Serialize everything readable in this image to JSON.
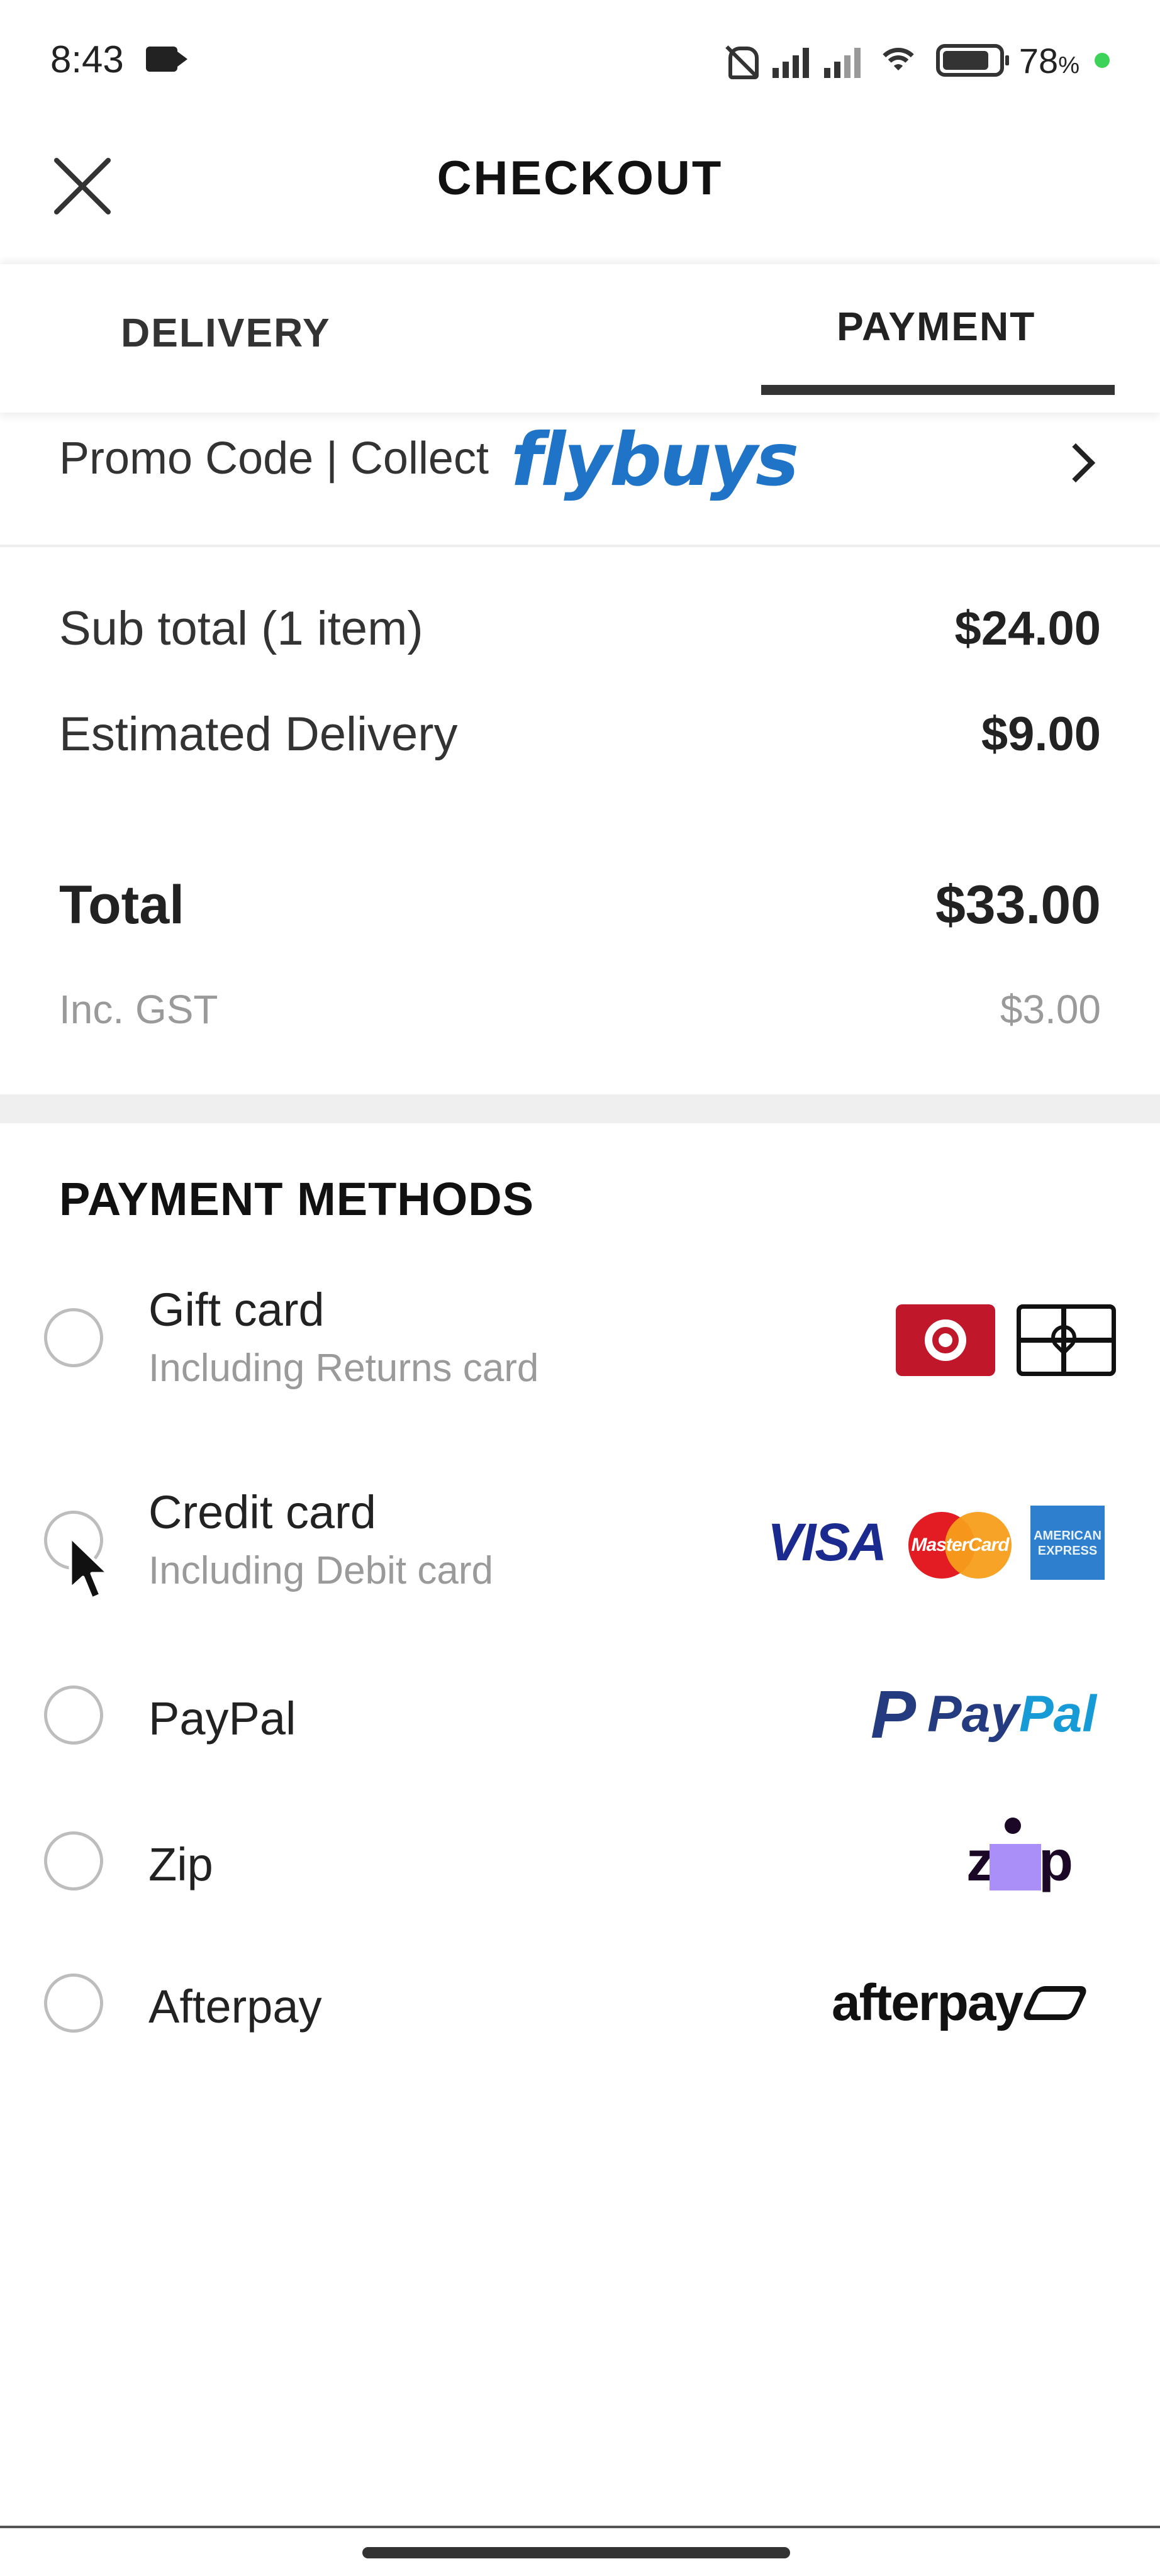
{
  "status_bar": {
    "time": "8:43",
    "battery_text": "78",
    "battery_unit": "%",
    "icons": [
      "video-camera-icon",
      "mute-bell-icon",
      "signal-icon",
      "signal-icon",
      "wifi-icon",
      "battery-icon"
    ]
  },
  "header": {
    "title": "CHECKOUT",
    "close_icon": "close-icon"
  },
  "tabs": [
    {
      "label": "DELIVERY",
      "active": false
    },
    {
      "label": "PAYMENT",
      "active": true
    }
  ],
  "promo": {
    "label": "Promo Code | Collect",
    "brand": "flybuys",
    "chevron_icon": "chevron-right-icon",
    "brand_color": "#1f74c8"
  },
  "summary": {
    "subtotal_label": "Sub total (1 item)",
    "subtotal_value": "$24.00",
    "delivery_label": "Estimated Delivery",
    "delivery_value": "$9.00",
    "total_label": "Total",
    "total_value": "$33.00",
    "gst_label": "Inc. GST",
    "gst_value": "$3.00"
  },
  "payment_methods": {
    "heading": "PAYMENT METHODS",
    "items": [
      {
        "title": "Gift card",
        "subtitle": "Including Returns card",
        "logos": [
          "target-gift-card-logo",
          "gift-card-logo"
        ],
        "selected": false
      },
      {
        "title": "Credit card",
        "subtitle": "Including Debit card",
        "logos": [
          "visa-logo",
          "mastercard-logo",
          "amex-logo"
        ],
        "selected": false
      },
      {
        "title": "PayPal",
        "subtitle": "",
        "logos": [
          "paypal-logo"
        ],
        "selected": false
      },
      {
        "title": "Zip",
        "subtitle": "",
        "logos": [
          "zip-logo"
        ],
        "selected": false
      },
      {
        "title": "Afterpay",
        "subtitle": "",
        "logos": [
          "afterpay-logo"
        ],
        "selected": false
      }
    ],
    "logo_text": {
      "visa": "VISA",
      "mastercard": "MasterCard",
      "amex_line1": "AMERICAN",
      "amex_line2": "EXPRESS",
      "paypal_mark": "P",
      "paypal_pay": "Pay",
      "paypal_pal": "Pal",
      "zip_z": "z",
      "zip_p": "p",
      "afterpay": "afterpay"
    }
  },
  "colors": {
    "accent_dark": "#333333",
    "target_red": "#c0182a",
    "visa_blue": "#1a2a8e",
    "mastercard_red": "#e31b23",
    "mastercard_orange": "#f79e1b",
    "amex_blue": "#2f7fcf",
    "paypal_dark": "#253b80",
    "paypal_light": "#179bd7",
    "zip_purple": "#aa8ff9",
    "battery_dot": "#3dd35a"
  }
}
